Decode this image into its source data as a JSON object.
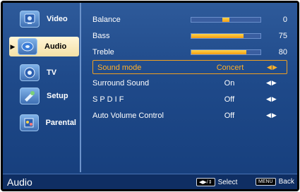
{
  "nav": {
    "items": [
      {
        "label": "Video",
        "icon": "video-icon"
      },
      {
        "label": "Audio",
        "icon": "audio-icon",
        "active": true
      },
      {
        "label": "TV",
        "icon": "tv-icon"
      },
      {
        "label": "Setup",
        "icon": "setup-icon"
      },
      {
        "label": "Parental",
        "icon": "parental-icon"
      }
    ]
  },
  "settings": {
    "balance": {
      "label": "Balance",
      "value": "0",
      "level": 0.5
    },
    "bass": {
      "label": "Bass",
      "value": "75",
      "level": 0.75
    },
    "treble": {
      "label": "Treble",
      "value": "80",
      "level": 0.8
    },
    "sound_mode": {
      "label": "Sound mode",
      "value": "Concert"
    },
    "surround": {
      "label": "Surround Sound",
      "value": "On"
    },
    "spdif": {
      "label": "S P D I F",
      "value": "Off"
    },
    "avc": {
      "label": "Auto Volume Control",
      "value": "Off"
    }
  },
  "footer": {
    "title": "Audio",
    "select_label": "Select",
    "menu_key": "MENU",
    "back_label": "Back"
  },
  "colors": {
    "accent": "#f39c12",
    "highlight_text": "#ffb02a",
    "background": "#1f4a8a"
  }
}
